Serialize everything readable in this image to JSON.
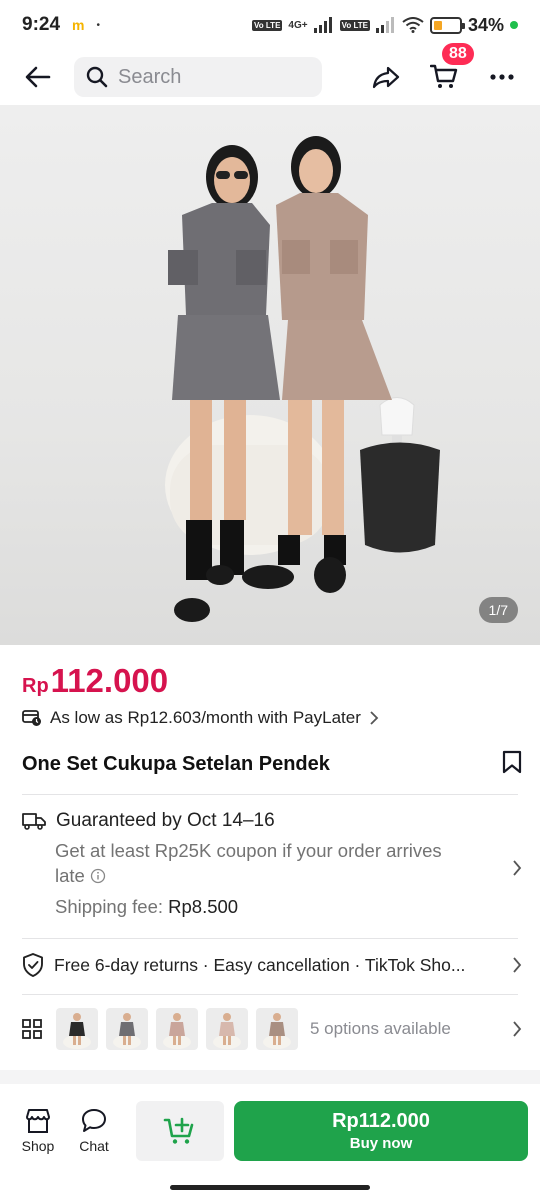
{
  "status_bar": {
    "time": "9:24",
    "carrier_icon": "m",
    "dot": "•",
    "network_1": "Vo LTE",
    "network_type": "4G+",
    "network_2": "Vo LTE",
    "battery_level": 0.34,
    "battery_text": "34%"
  },
  "topnav": {
    "search_placeholder": "Search",
    "cart_count": "88"
  },
  "gallery": {
    "counter": "1/7"
  },
  "product": {
    "currency": "Rp",
    "price": "112.000",
    "paylater_text": "As low as Rp12.603/month with PayLater",
    "title": "One Set Cukupa  Setelan Pendek"
  },
  "shipping": {
    "guarantee": "Guaranteed by Oct 14–16",
    "coupon_line1": "Get at least Rp25K coupon if your order arrives",
    "coupon_line2": "late",
    "fee_label": "Shipping fee:",
    "fee_value": "Rp8.500"
  },
  "returns": {
    "text": "Free 6-day returns · Easy cancellation · TikTok Sho..."
  },
  "options": {
    "label": "5 options available",
    "thumb_colors": [
      "#2a2a2a",
      "#6f6e73",
      "#c9a59b",
      "#d7b8ad",
      "#a98f82"
    ]
  },
  "bottom_bar": {
    "shop_label": "Shop",
    "chat_label": "Chat",
    "buy_price": "Rp112.000",
    "buy_label": "Buy now"
  },
  "colors": {
    "accent_price": "#d6134e",
    "buy_green": "#1fa34b",
    "badge_red": "#fe2c55"
  }
}
